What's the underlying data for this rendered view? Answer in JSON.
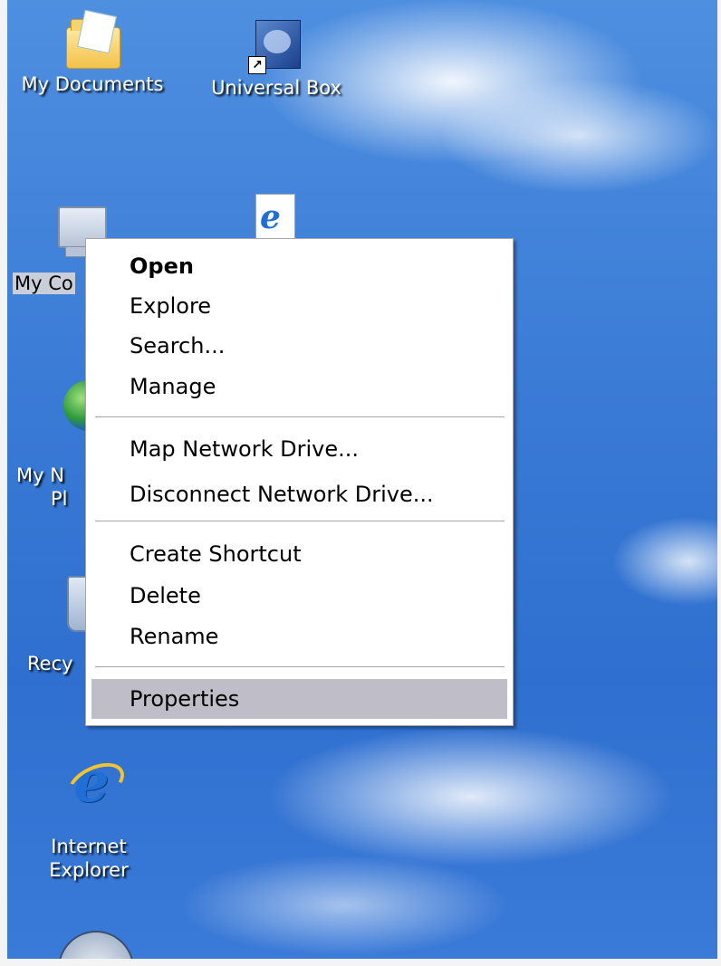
{
  "desktop": {
    "icons": [
      {
        "label": "My Documents",
        "icon": "folder-documents-icon"
      },
      {
        "label": "Universal Box",
        "icon": "universal-box-shortcut-icon"
      },
      {
        "label": "My Co",
        "icon": "my-computer-icon"
      },
      {
        "label": "",
        "icon": "ie-document-icon"
      },
      {
        "label_line1": "My N",
        "label_line2": "Pl",
        "icon": "network-places-icon"
      },
      {
        "label": "Recy",
        "icon": "recycle-bin-icon"
      },
      {
        "label_line1": "Internet",
        "label_line2": "Explorer",
        "icon": "internet-explorer-icon"
      },
      {
        "label": "",
        "icon": "partial-app-icon"
      }
    ]
  },
  "context_menu": {
    "items": [
      {
        "label": "Open",
        "bold": true
      },
      {
        "label": "Explore"
      },
      {
        "label": "Search..."
      },
      {
        "label": "Manage"
      },
      {
        "separator": true
      },
      {
        "label": "Map Network Drive..."
      },
      {
        "label": "Disconnect Network Drive..."
      },
      {
        "separator": true
      },
      {
        "label": "Create Shortcut"
      },
      {
        "label": "Delete"
      },
      {
        "label": "Rename"
      },
      {
        "separator": true
      },
      {
        "label": "Properties",
        "highlighted": true
      }
    ],
    "highlight_color": "#bfbdc7"
  }
}
